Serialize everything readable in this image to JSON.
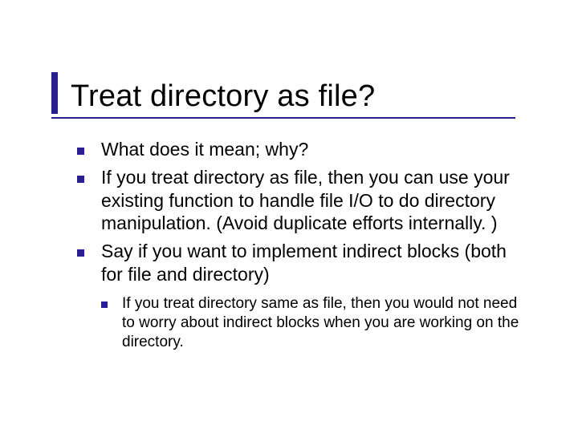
{
  "title": "Treat directory as file?",
  "bullets": [
    {
      "text": "What does it mean; why?"
    },
    {
      "text": "If you treat directory as file, then you can use your existing function to handle file I/O to do directory manipulation. (Avoid duplicate efforts internally. )"
    },
    {
      "text": "Say if you want to implement indirect blocks (both for file and directory)",
      "sub": [
        {
          "text": "If you treat directory same as file, then you would not need to worry about indirect blocks when you are working on the directory."
        }
      ]
    }
  ]
}
